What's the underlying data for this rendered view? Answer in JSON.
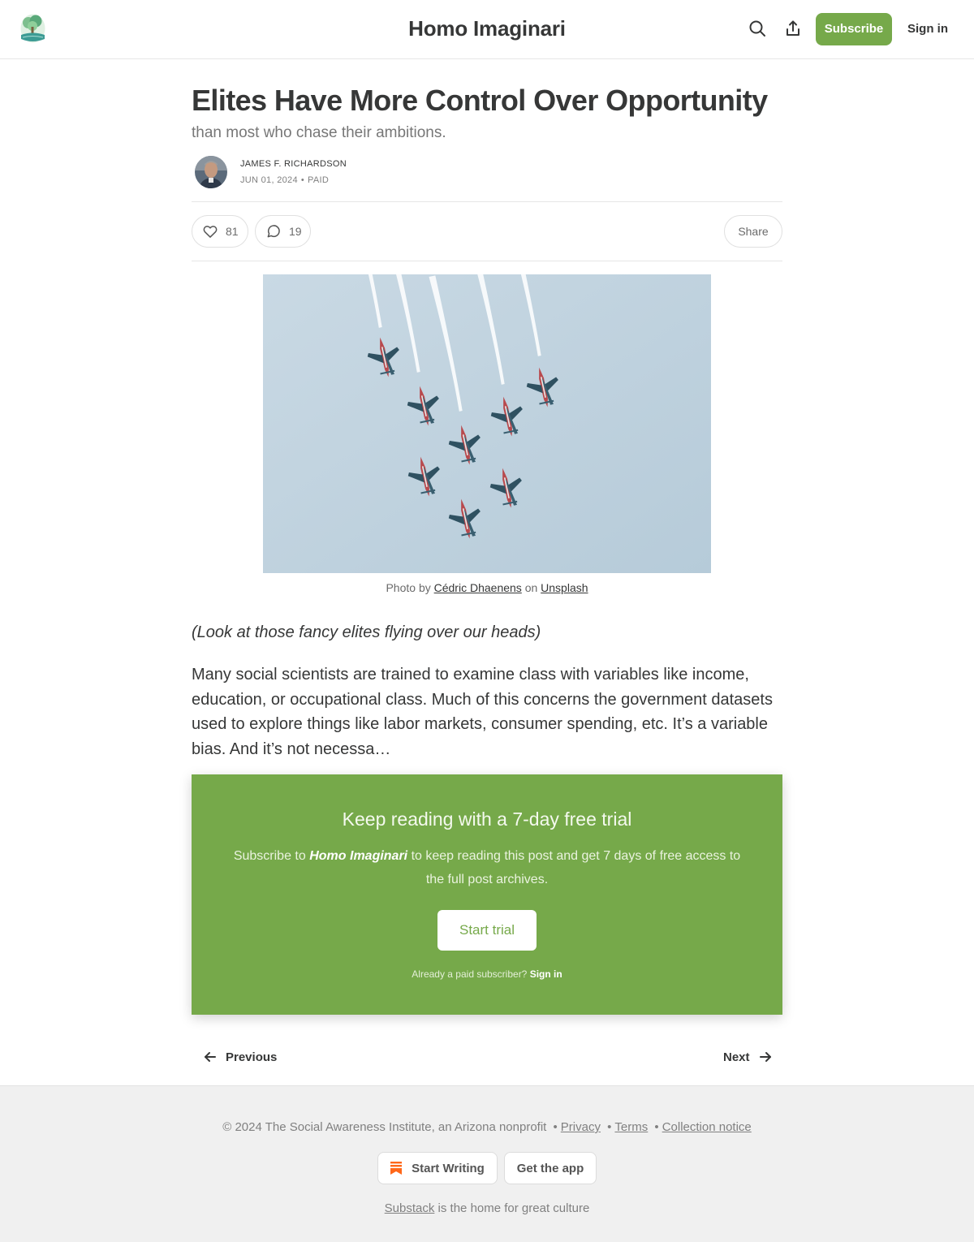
{
  "header": {
    "publication": "Homo Imaginari",
    "subscribe_label": "Subscribe",
    "signin_label": "Sign in",
    "logo_icon": "tree-logo-icon",
    "search_icon": "search-icon",
    "share_icon": "share-icon"
  },
  "post": {
    "title": "Elites Have More Control Over Opportunity",
    "subtitle": "than most who chase their ambitions.",
    "author": "JAMES F. RICHARDSON",
    "date": "JUN 01, 2024",
    "access": "PAID",
    "likes": "81",
    "comments": "19",
    "share_label": "Share"
  },
  "image": {
    "caption_prefix": "Photo by",
    "photographer": "Cédric Dhaenens",
    "caption_mid": "on",
    "source": "Unsplash"
  },
  "body": {
    "italic_line": "(Look at those fancy elites flying over our heads)",
    "paragraph": "Many social scientists are trained to examine class with variables like income, education, or occupational class. Much of this concerns the government datasets used to explore things like labor markets, consumer spending, etc. It’s a variable bias. And it’s not necessa…"
  },
  "paywall": {
    "heading": "Keep reading with a 7-day free trial",
    "text_prefix": "Subscribe to",
    "text_pub": "Homo Imaginari",
    "text_suffix": "to keep reading this post and get 7 days of free access to the full post archives.",
    "button": "Start trial",
    "already": "Already a paid subscriber?",
    "signin": "Sign in",
    "color": "#76a94a"
  },
  "nav": {
    "previous": "Previous",
    "next": "Next"
  },
  "footer": {
    "copyright": "© 2024 The Social Awareness Institute, an Arizona nonprofit",
    "privacy": "Privacy",
    "terms": "Terms",
    "collection": "Collection notice",
    "start_writing": "Start Writing",
    "get_app": "Get the app",
    "substack": "Substack",
    "tagline_suffix": "is the home for great culture"
  }
}
